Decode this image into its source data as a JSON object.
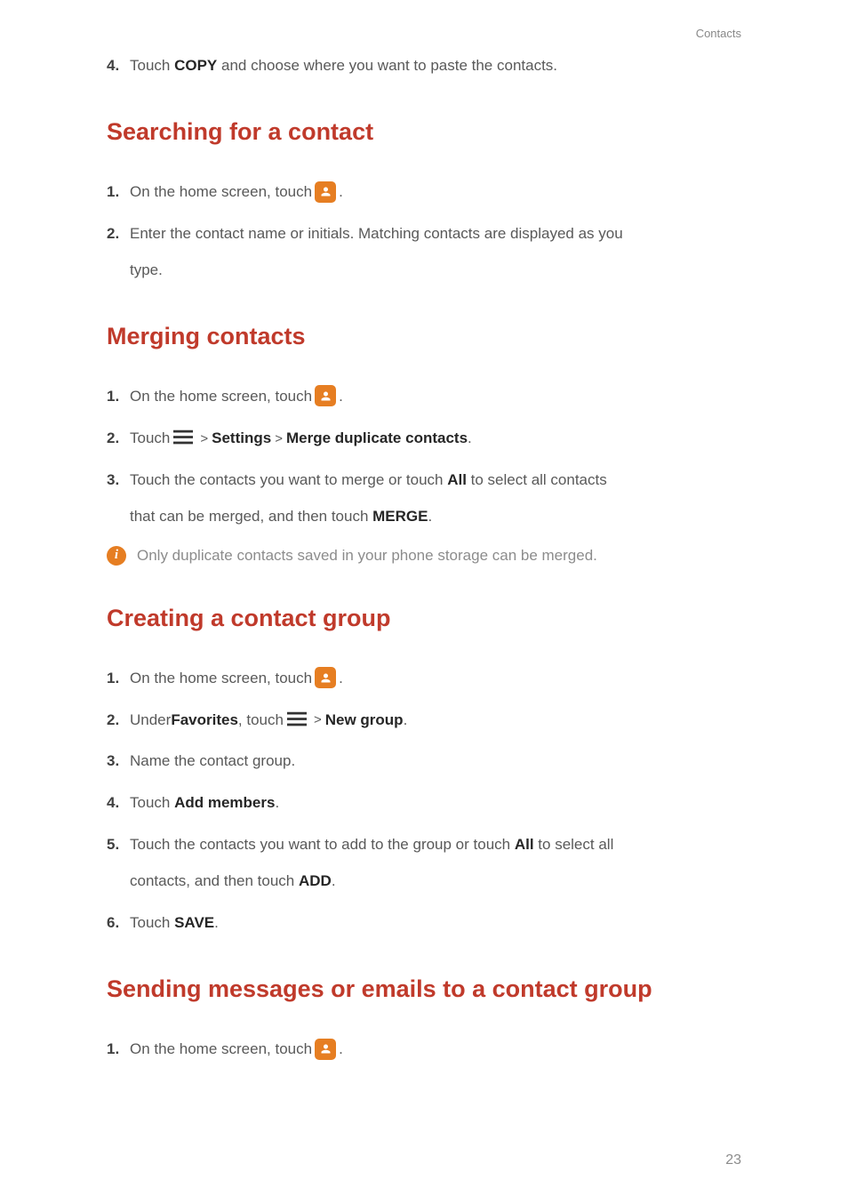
{
  "header": {
    "section": "Contacts"
  },
  "topStep": {
    "num": "4.",
    "textA": "Touch ",
    "bold": "COPY",
    "textB": " and choose where you want to paste the contacts."
  },
  "section1": {
    "heading": "Searching for a contact",
    "step1": {
      "num": "1.",
      "text": "On the home screen, touch ",
      "period": "."
    },
    "step2": {
      "num": "2.",
      "text": "Enter the contact name or initials. Matching contacts are displayed as you ",
      "cont": "type."
    }
  },
  "section2": {
    "heading": "Merging contacts",
    "step1": {
      "num": "1.",
      "text": "On the home screen, touch ",
      "period": "."
    },
    "step2": {
      "num": "2.",
      "text": "Touch ",
      "gt1": ">",
      "bold1": "Settings",
      "gt2": ">",
      "bold2": "Merge duplicate contacts",
      "period": "."
    },
    "step3": {
      "num": "3.",
      "text1": "Touch the contacts you want to merge or touch ",
      "bold1": "All",
      "text2": " to select all contacts ",
      "cont1": "that can be merged, and then touch ",
      "bold2": "MERGE",
      "period": "."
    },
    "note": "Only duplicate contacts saved in your phone storage can be merged."
  },
  "section3": {
    "heading": "Creating a contact group",
    "step1": {
      "num": "1.",
      "text": "On the home screen, touch ",
      "period": "."
    },
    "step2": {
      "num": "2.",
      "text1": "Under ",
      "bold1": "Favorites",
      "text2": ", touch ",
      "gt": ">",
      "bold2": "New group",
      "period": "."
    },
    "step3": {
      "num": "3.",
      "text": "Name the contact group."
    },
    "step4": {
      "num": "4.",
      "text": "Touch ",
      "bold": "Add members",
      "period": "."
    },
    "step5": {
      "num": "5.",
      "text1": "Touch the contacts you want to add to the group or touch ",
      "bold1": "All",
      "text2": " to select all ",
      "cont1": "contacts, and then touch ",
      "bold2": "ADD",
      "period": "."
    },
    "step6": {
      "num": "6.",
      "text": "Touch ",
      "bold": "SAVE",
      "period": "."
    }
  },
  "section4": {
    "heading": "Sending messages or emails to a contact group",
    "step1": {
      "num": "1.",
      "text": "On the home screen, touch ",
      "period": "."
    }
  },
  "pageNumber": "23",
  "infoGlyph": "i"
}
